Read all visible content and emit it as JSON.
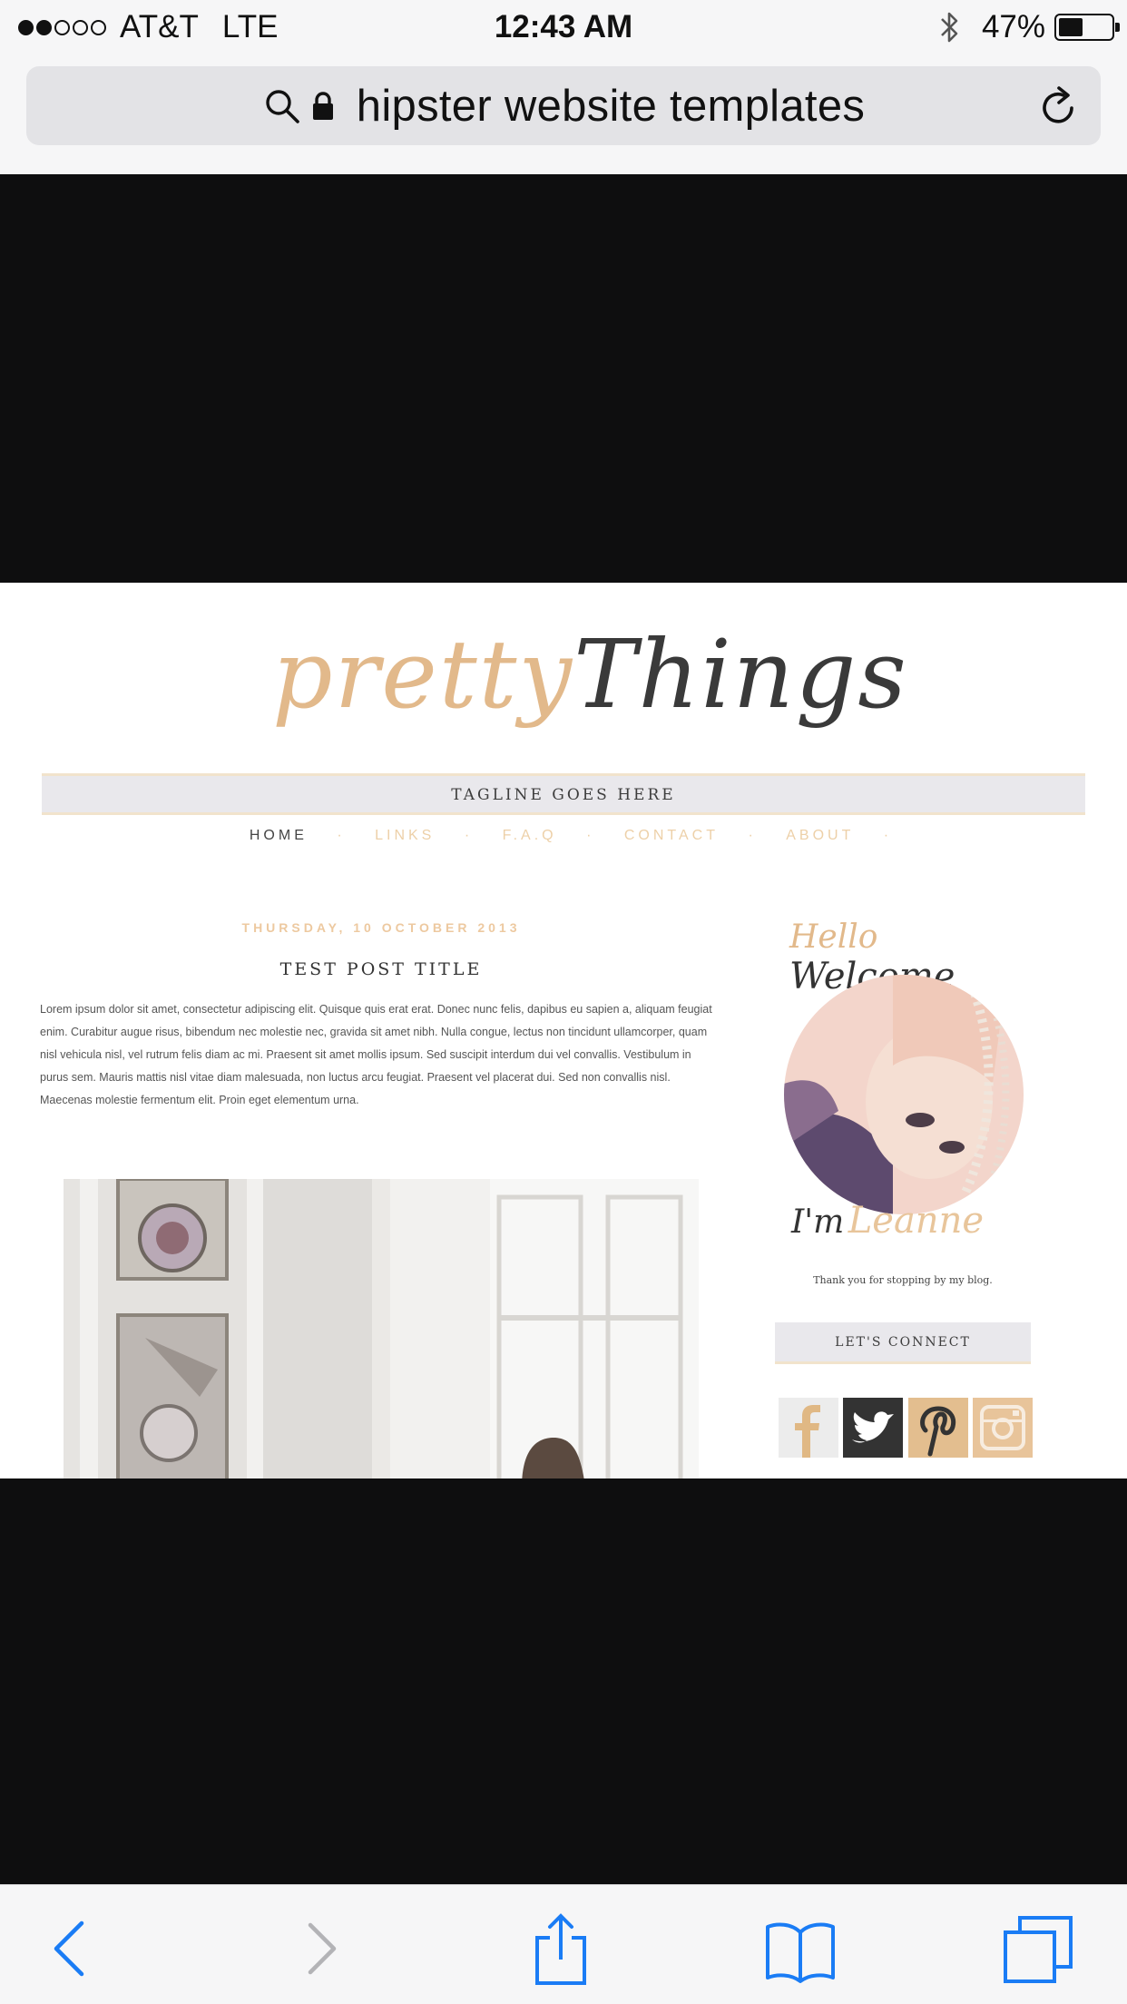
{
  "status_bar": {
    "signal_dots": 5,
    "signal_filled": 2,
    "carrier": "AT&T",
    "network": "LTE",
    "time": "12:43 AM",
    "battery_percent": "47%",
    "battery_level": 0.47,
    "icons": [
      "bluetooth-icon",
      "battery-icon"
    ]
  },
  "address_bar": {
    "query": "hipster website templates",
    "icons": [
      "search-icon",
      "lock-icon",
      "reload-icon"
    ]
  },
  "preview": {
    "logo": {
      "part1": "pretty",
      "part2": "Things"
    },
    "tagline": "TAGLINE GOES HERE",
    "nav": {
      "home": "HOME",
      "links": "LINKS",
      "faq": "F.A.Q",
      "contact": "CONTACT",
      "about": "ABOUT",
      "separator": "·"
    },
    "post": {
      "date": "THURSDAY, 10 OCTOBER 2013",
      "title": "TEST POST TITLE",
      "body": "Lorem ipsum dolor sit amet, consectetur adipiscing elit. Quisque quis erat erat. Donec nunc felis, dapibus eu sapien a, aliquam feugiat enim. Curabitur augue risus, bibendum nec molestie nec, gravida sit amet nibh. Nulla congue, lectus non tincidunt ullamcorper, quam nisl vehicula nisl, vel rutrum felis diam ac mi. Praesent sit amet mollis ipsum. Sed suscipit interdum dui vel convallis. Vestibulum in purus sem. Mauris mattis nisl vitae diam malesuada, non luctus arcu feugiat. Praesent vel placerat dui. Sed non convallis nisl. Maecenas molestie fermentum elit. Proin eget elementum urna."
    },
    "sidebar": {
      "hello": "Hello",
      "welcome": "Welcome",
      "im": "I'm",
      "name": "Leanne",
      "thanks": "Thank you for stopping by my blog.",
      "connect": "LET'S CONNECT",
      "social_icons": [
        "facebook-icon",
        "twitter-icon",
        "pinterest-icon",
        "instagram-icon"
      ]
    },
    "colors": {
      "gold": "#e2b98b",
      "dark": "#333333",
      "bar": "#e9e8ec"
    }
  },
  "toolbar": {
    "icons": [
      "back-icon",
      "forward-icon",
      "share-icon",
      "bookmarks-icon",
      "tabs-icon"
    ],
    "accent": "#1a7cf5"
  }
}
